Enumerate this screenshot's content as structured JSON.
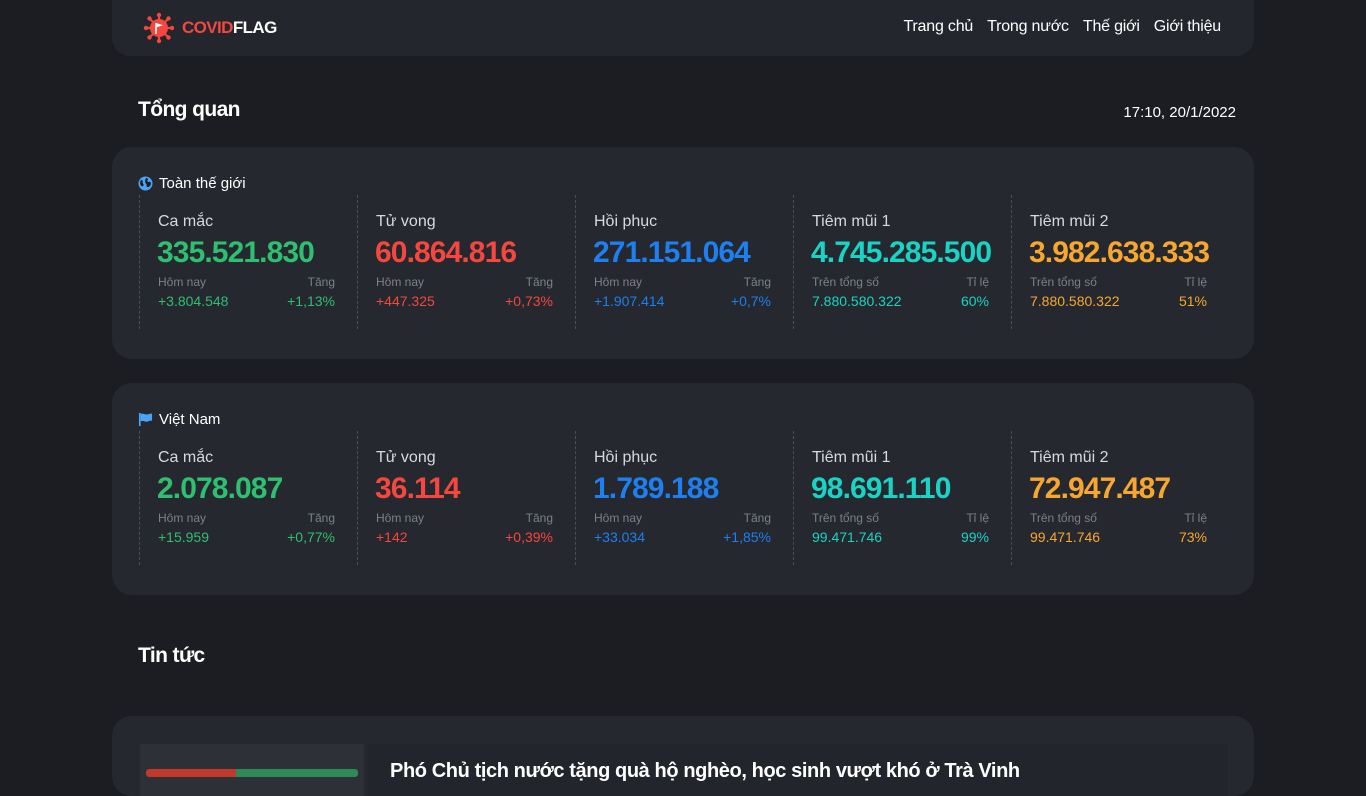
{
  "brand": {
    "covid": "COVID",
    "flag": "FLAG"
  },
  "nav": [
    "Trang chủ",
    "Trong nước",
    "Thế giới",
    "Giới thiệu"
  ],
  "overview": {
    "title": "Tổng quan",
    "updated": "17:10, 20/1/2022"
  },
  "world": {
    "title": "Toàn thế giới",
    "stats": [
      {
        "label": "Ca mắc",
        "value": "335.521.830",
        "sub_left": "Hôm nay",
        "sub_right": "Tăng",
        "left_value": "+3.804.548",
        "right_value": "+1,13%",
        "color": "#2fbf71"
      },
      {
        "label": "Tử vong",
        "value": "60.864.816",
        "sub_left": "Hôm nay",
        "sub_right": "Tăng",
        "left_value": "+447.325",
        "right_value": "+0,73%",
        "color": "#f4473f"
      },
      {
        "label": "Hồi phục",
        "value": "271.151.064",
        "sub_left": "Hôm nay",
        "sub_right": "Tăng",
        "left_value": "+1.907.414",
        "right_value": "+0,7%",
        "color": "#1e7ff0"
      },
      {
        "label": "Tiêm mũi 1",
        "value": "4.745.285.500",
        "sub_left": "Trên tổng số",
        "sub_right": "Tỉ lệ",
        "left_value": "7.880.580.322",
        "right_value": "60%",
        "color": "#19d3c5"
      },
      {
        "label": "Tiêm mũi 2",
        "value": "3.982.638.333",
        "sub_left": "Trên tổng số",
        "sub_right": "Tỉ lệ",
        "left_value": "7.880.580.322",
        "right_value": "51%",
        "color": "#f7a72f"
      }
    ]
  },
  "vietnam": {
    "title": "Việt Nam",
    "stats": [
      {
        "label": "Ca mắc",
        "value": "2.078.087",
        "sub_left": "Hôm nay",
        "sub_right": "Tăng",
        "left_value": "+15.959",
        "right_value": "+0,77%",
        "color": "#2fbf71"
      },
      {
        "label": "Tử vong",
        "value": "36.114",
        "sub_left": "Hôm nay",
        "sub_right": "Tăng",
        "left_value": "+142",
        "right_value": "+0,39%",
        "color": "#f4473f"
      },
      {
        "label": "Hồi phục",
        "value": "1.789.188",
        "sub_left": "Hôm nay",
        "sub_right": "Tăng",
        "left_value": "+33.034",
        "right_value": "+1,85%",
        "color": "#1e7ff0"
      },
      {
        "label": "Tiêm mũi 1",
        "value": "98.691.110",
        "sub_left": "Trên tổng số",
        "sub_right": "Tỉ lệ",
        "left_value": "99.471.746",
        "right_value": "99%",
        "color": "#19d3c5"
      },
      {
        "label": "Tiêm mũi 2",
        "value": "72.947.487",
        "sub_left": "Trên tổng số",
        "sub_right": "Tỉ lệ",
        "left_value": "99.471.746",
        "right_value": "73%",
        "color": "#f7a72f"
      }
    ]
  },
  "news": {
    "title": "Tin tức",
    "headline": "Phó Chủ tịch nước tặng quà hộ nghèo, học sinh vượt khó ở Trà Vinh"
  }
}
